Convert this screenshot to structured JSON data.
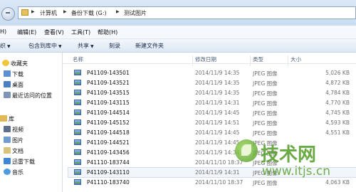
{
  "breadcrumb": [
    "计算机",
    "备份下载 (G:)",
    "测试图片"
  ],
  "menu": [
    "编辑(E)",
    "查看(V)",
    "工具(T)",
    "帮助(H)"
  ],
  "menu_partial": "H)",
  "toolbar": {
    "organize_partial": "织",
    "include_library": "包含到库中",
    "share": "共享",
    "burn": "刻录",
    "new_folder": "新建文件夹"
  },
  "nav": [
    {
      "label": "收藏夹",
      "icon": "star-icon"
    },
    {
      "label": "下载",
      "icon": "download-folder-icon"
    },
    {
      "label": "桌面",
      "icon": "desktop-icon"
    },
    {
      "label": "最近访问的位置",
      "icon": "recent-places-icon"
    },
    {
      "label": "库",
      "icon": "library-icon"
    },
    {
      "label": "视频",
      "icon": "video-library-icon"
    },
    {
      "label": "图片",
      "icon": "pictures-library-icon"
    },
    {
      "label": "文档",
      "icon": "documents-library-icon"
    },
    {
      "label": "迅雷下载",
      "icon": "thunder-download-icon"
    },
    {
      "label": "音乐",
      "icon": "music-library-icon"
    }
  ],
  "columns": {
    "name": "名称",
    "date": "修改日期",
    "type": "类型",
    "size": "大小"
  },
  "files": [
    {
      "name": "P41109-143501",
      "date": "2014/11/9 14:35",
      "type": "JPEG 图像",
      "size": "5,026 KB"
    },
    {
      "name": "P41109-143521",
      "date": "2014/11/9 14:35",
      "type": "JPEG 图像",
      "size": "4,872 KB"
    },
    {
      "name": "P41109-143515",
      "date": "2014/11/9 14:35",
      "type": "JPEG 图像",
      "size": "4,784 KB"
    },
    {
      "name": "P41109-143115",
      "date": "2014/11/9 14:31",
      "type": "JPEG 图像",
      "size": "4,770 KB"
    },
    {
      "name": "P41109-144514",
      "date": "2014/11/9 14:45",
      "type": "JPEG 图像",
      "size": "4,745 KB"
    },
    {
      "name": "P41109-145152",
      "date": "2014/11/9 14:51",
      "type": "JPEG 图像",
      "size": "4,593 KB"
    },
    {
      "name": "P41109-144518",
      "date": "2014/11/9 14:45",
      "type": "JPEG 图像",
      "size": "4,551 KB"
    },
    {
      "name": "P41109-144521",
      "date": "2014/11/9 14:45",
      "type": "JPEG 图像",
      "size": ""
    },
    {
      "name": "P41109-143456",
      "date": "2014/11/9 14:34",
      "type": "JPEG 图像",
      "size": ""
    },
    {
      "name": "P41110-183744",
      "date": "2014/11/10 18:37",
      "type": "JPEG 图像",
      "size": ""
    },
    {
      "name": "P41109-143110",
      "date": "2014/11/9 14:31",
      "type": "JPEG 图像",
      "size": ""
    },
    {
      "name": "P41110-183740",
      "date": "2014/11/10 18:37",
      "type": "JPEG 图像",
      "size": "4,063 KB"
    }
  ],
  "watermark": {
    "text": "技术网",
    "url": "www.itjs.cn"
  },
  "colors": {
    "accent": "#3f7cc0",
    "watermark": "#5aa130"
  }
}
